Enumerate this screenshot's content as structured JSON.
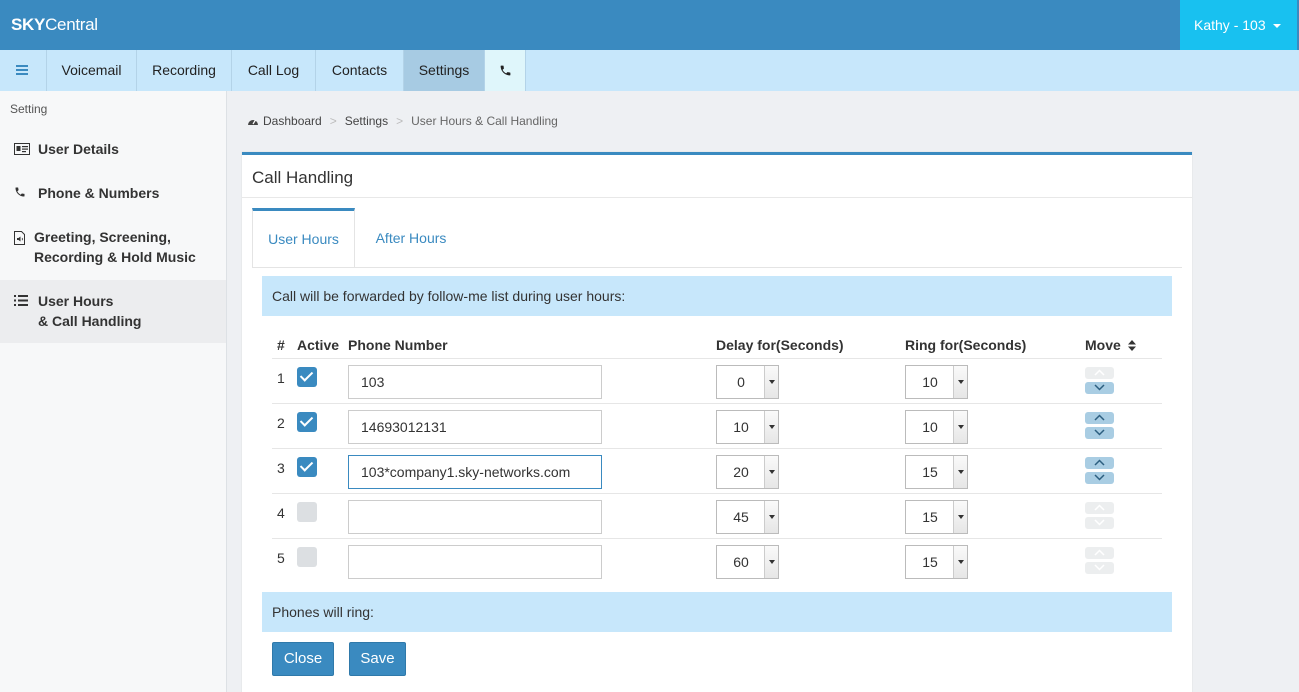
{
  "app": {
    "brand_bold": "SKY",
    "brand_rest": "Central",
    "user_label": "Kathy - 103"
  },
  "nav": {
    "items": [
      "Voicemail",
      "Recording",
      "Call Log",
      "Contacts",
      "Settings"
    ]
  },
  "sidebar": {
    "title": "Setting",
    "items": [
      {
        "line1": "User Details",
        "line2": ""
      },
      {
        "line1": "Phone & Numbers",
        "line2": ""
      },
      {
        "line1": "Greeting, Screening,",
        "line2": "Recording & Hold Music"
      },
      {
        "line1": "User Hours",
        "line2": "& Call Handling"
      }
    ]
  },
  "breadcrumb": {
    "home": "Dashboard",
    "section": "Settings",
    "current": "User Hours & Call Handling"
  },
  "panel": {
    "title": "Call Handling",
    "tabs": [
      "User Hours",
      "After Hours"
    ],
    "info_text": "Call will be forwarded by follow-me list during user hours:",
    "ring_text": "Phones will ring:"
  },
  "table": {
    "headers": {
      "num": "#",
      "active": "Active",
      "phone": "Phone Number",
      "delay": "Delay for(Seconds)",
      "ring": "Ring for(Seconds)",
      "move": "Move"
    },
    "rows": [
      {
        "num": "1",
        "active": true,
        "phone": "103",
        "delay": "0",
        "ring": "10"
      },
      {
        "num": "2",
        "active": true,
        "phone": "14693012131",
        "delay": "10",
        "ring": "10"
      },
      {
        "num": "3",
        "active": true,
        "phone": "103*company1.sky-networks.com",
        "delay": "20",
        "ring": "15"
      },
      {
        "num": "4",
        "active": false,
        "phone": "",
        "delay": "45",
        "ring": "15"
      },
      {
        "num": "5",
        "active": false,
        "phone": "",
        "delay": "60",
        "ring": "15"
      }
    ]
  },
  "buttons": {
    "close": "Close",
    "save": "Save"
  }
}
